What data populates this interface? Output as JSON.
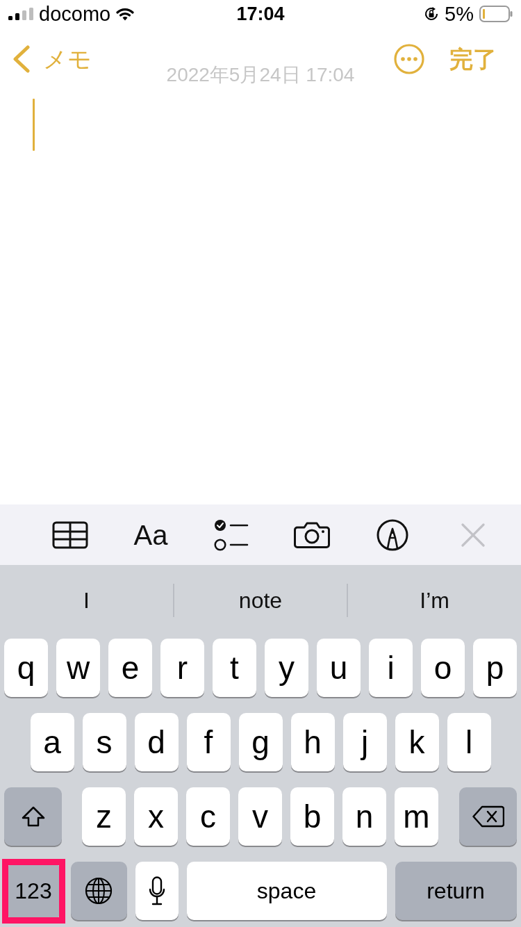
{
  "status_bar": {
    "carrier": "docomo",
    "time": "17:04",
    "battery_percent": "5%"
  },
  "nav_bar": {
    "back_label": "メモ",
    "done_label": "完了"
  },
  "note": {
    "date": "2022年5月24日 17:04"
  },
  "toolbar": {
    "format_label": "Aa"
  },
  "suggestions": [
    {
      "text": "I"
    },
    {
      "text": "note"
    },
    {
      "text": "I’m"
    }
  ],
  "keyboard": {
    "key_rows": [
      {
        "keys": [
          {
            "kind": "letter",
            "label": "q"
          },
          {
            "kind": "letter",
            "label": "w"
          },
          {
            "kind": "letter",
            "label": "e"
          },
          {
            "kind": "letter",
            "label": "r"
          },
          {
            "kind": "letter",
            "label": "t"
          },
          {
            "kind": "letter",
            "label": "y"
          },
          {
            "kind": "letter",
            "label": "u"
          },
          {
            "kind": "letter",
            "label": "i"
          },
          {
            "kind": "letter",
            "label": "o"
          },
          {
            "kind": "letter",
            "label": "p"
          }
        ]
      },
      {
        "keys": [
          {
            "kind": "letter",
            "label": "a"
          },
          {
            "kind": "letter",
            "label": "s"
          },
          {
            "kind": "letter",
            "label": "d"
          },
          {
            "kind": "letter",
            "label": "f"
          },
          {
            "kind": "letter",
            "label": "g"
          },
          {
            "kind": "letter",
            "label": "h"
          },
          {
            "kind": "letter",
            "label": "j"
          },
          {
            "kind": "letter",
            "label": "k"
          },
          {
            "kind": "letter",
            "label": "l"
          }
        ]
      },
      {
        "keys": [
          {
            "kind": "shift"
          },
          {
            "kind": "letter",
            "label": "z"
          },
          {
            "kind": "letter",
            "label": "x"
          },
          {
            "kind": "letter",
            "label": "c"
          },
          {
            "kind": "letter",
            "label": "v"
          },
          {
            "kind": "letter",
            "label": "b"
          },
          {
            "kind": "letter",
            "label": "n"
          },
          {
            "kind": "letter",
            "label": "m"
          },
          {
            "kind": "delete"
          }
        ]
      },
      {
        "keys": [
          {
            "kind": "numbers",
            "label": "123",
            "highlighted": true
          },
          {
            "kind": "globe",
            "highlighted": false
          },
          {
            "kind": "mic",
            "highlighted": false
          },
          {
            "kind": "space",
            "label": "space",
            "highlighted": false
          },
          {
            "kind": "return",
            "label": "return",
            "highlighted": false
          }
        ]
      }
    ]
  }
}
